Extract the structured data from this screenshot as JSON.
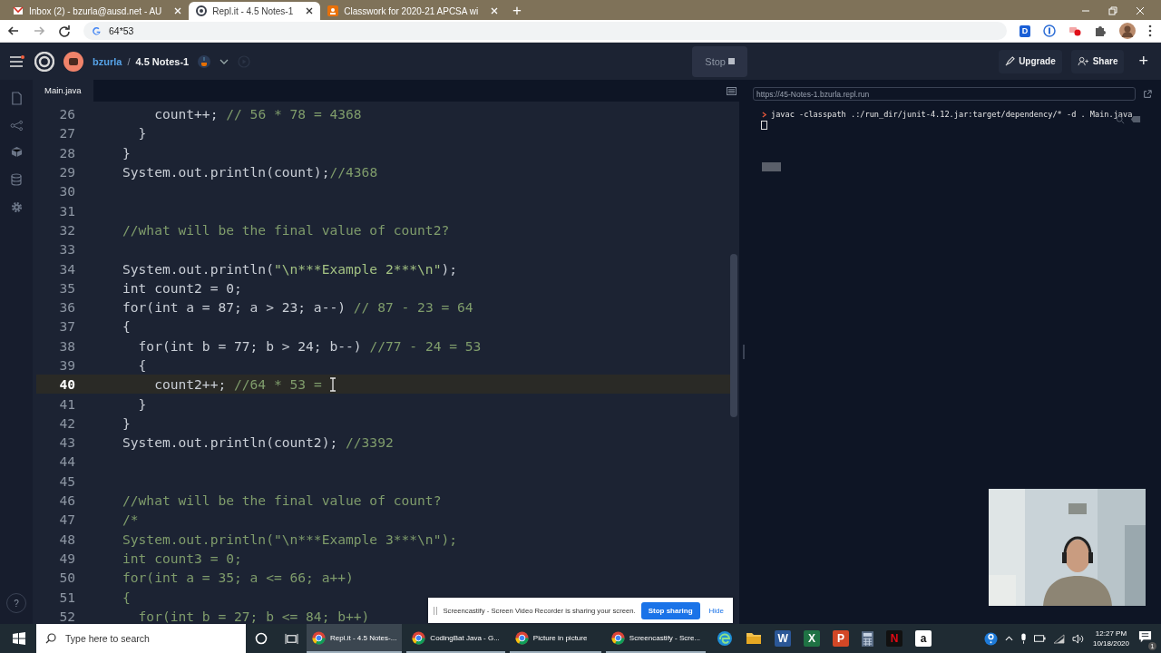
{
  "browser": {
    "tabs": [
      {
        "title": "Inbox (2) - bzurla@ausd.net - AU",
        "kind": "mail",
        "selected": false
      },
      {
        "title": "Repl.it - 4.5 Notes-1",
        "kind": "replit",
        "selected": true
      },
      {
        "title": "Classwork for 2020-21 APCSA wi",
        "kind": "classroom",
        "selected": false
      }
    ],
    "new_tab": "+",
    "address": "64*53",
    "extensions": [
      {
        "kind": "letter",
        "label": "D"
      },
      {
        "kind": "ring"
      },
      {
        "kind": "record"
      },
      {
        "kind": "puzzle"
      }
    ]
  },
  "header": {
    "user": "bzurla",
    "separator": "/",
    "project": "4.5 Notes-1",
    "stop_button": "Stop",
    "upgrade_button": "Upgrade",
    "share_button": "Share",
    "add_button": "+"
  },
  "editor": {
    "file_tab": "Main.java",
    "lines": [
      {
        "number": "26",
        "current": false,
        "parts": [
          {
            "kind": "code",
            "text": "    count++; "
          },
          {
            "kind": "comment",
            "text": "// 56 * 78 = 4368"
          }
        ]
      },
      {
        "number": "27",
        "current": false,
        "parts": [
          {
            "kind": "code",
            "text": "  }"
          }
        ]
      },
      {
        "number": "28",
        "current": false,
        "parts": [
          {
            "kind": "code",
            "text": "}"
          }
        ]
      },
      {
        "number": "29",
        "current": false,
        "parts": [
          {
            "kind": "code",
            "text": "System.out.println(count);"
          },
          {
            "kind": "comment",
            "text": "//4368"
          }
        ]
      },
      {
        "number": "30",
        "current": false
      },
      {
        "number": "31",
        "current": false
      },
      {
        "number": "32",
        "current": false,
        "parts": [
          {
            "kind": "comment",
            "text": "//what will be the final value of count2?"
          }
        ]
      },
      {
        "number": "33",
        "current": false
      },
      {
        "number": "34",
        "current": false,
        "parts": [
          {
            "kind": "code",
            "text": "System.out.println("
          },
          {
            "kind": "string",
            "text": "\"\\n***Example 2***\\n\""
          },
          {
            "kind": "code",
            "text": ");"
          }
        ]
      },
      {
        "number": "35",
        "current": false,
        "parts": [
          {
            "kind": "code",
            "text": "int count2 = 0;"
          }
        ]
      },
      {
        "number": "36",
        "current": false,
        "parts": [
          {
            "kind": "code",
            "text": "for(int a = 87; a > 23; a--) "
          },
          {
            "kind": "comment",
            "text": "// 87 - 23 = 64"
          }
        ]
      },
      {
        "number": "37",
        "current": false,
        "parts": [
          {
            "kind": "code",
            "text": "{"
          }
        ]
      },
      {
        "number": "38",
        "current": false,
        "parts": [
          {
            "kind": "code",
            "text": "  for(int b = 77; b > 24; b--) "
          },
          {
            "kind": "comment",
            "text": "//77 - 24 = 53"
          }
        ]
      },
      {
        "number": "39",
        "current": false,
        "parts": [
          {
            "kind": "code",
            "text": "  {"
          }
        ]
      },
      {
        "number": "40",
        "current": true,
        "parts": [
          {
            "kind": "code",
            "text": "    count2++; "
          },
          {
            "kind": "comment",
            "text": "//64 * 53 = "
          }
        ]
      },
      {
        "number": "41",
        "current": false,
        "parts": [
          {
            "kind": "code",
            "text": "  }"
          }
        ]
      },
      {
        "number": "42",
        "current": false,
        "parts": [
          {
            "kind": "code",
            "text": "}"
          }
        ]
      },
      {
        "number": "43",
        "current": false,
        "parts": [
          {
            "kind": "code",
            "text": "System.out.println(count2); "
          },
          {
            "kind": "comment",
            "text": "//3392"
          }
        ]
      },
      {
        "number": "44",
        "current": false
      },
      {
        "number": "45",
        "current": false
      },
      {
        "number": "46",
        "current": false,
        "parts": [
          {
            "kind": "comment",
            "text": "//what will be the final value of count?"
          }
        ]
      },
      {
        "number": "47",
        "current": false,
        "parts": [
          {
            "kind": "comment",
            "text": "/*"
          }
        ]
      },
      {
        "number": "48",
        "current": false,
        "parts": [
          {
            "kind": "comment",
            "text": "System.out.println(\"\\n***Example 3***\\n\");"
          }
        ]
      },
      {
        "number": "49",
        "current": false,
        "parts": [
          {
            "kind": "comment",
            "text": "int count3 = 0;"
          }
        ]
      },
      {
        "number": "50",
        "current": false,
        "parts": [
          {
            "kind": "comment",
            "text": "for(int a = 35; a <= 66; a++)"
          }
        ]
      },
      {
        "number": "51",
        "current": false,
        "parts": [
          {
            "kind": "comment",
            "text": "{"
          }
        ]
      },
      {
        "number": "52",
        "current": false,
        "parts": [
          {
            "kind": "comment",
            "text": "  for(int b = 27; b <= 84; b++)"
          }
        ]
      }
    ]
  },
  "console": {
    "url": "https://45-Notes-1.bzurla.repl.run",
    "command": "javac -classpath .:/run_dir/junit-4.12.jar:target/dependency/* -d . Main.java"
  },
  "help_button": "?",
  "sharing_bar": {
    "message": "Screencastify - Screen Video Recorder is sharing your screen.",
    "stop_button": "Stop sharing",
    "hide_link": "Hide"
  },
  "taskbar": {
    "search_placeholder": "Type here to search",
    "windows": [
      {
        "title": "Repl.it - 4.5 Notes-...",
        "selected": true
      },
      {
        "title": "CodingBat Java - G...",
        "selected": false
      },
      {
        "title": "Picture in picture",
        "selected": false
      },
      {
        "title": "Screencastify - Scre...",
        "selected": false
      }
    ],
    "pinned": [
      {
        "kind": "edge"
      },
      {
        "kind": "folder"
      },
      {
        "kind": "word",
        "label": "W"
      },
      {
        "kind": "excel",
        "label": "X"
      },
      {
        "kind": "powerpoint",
        "label": "P"
      },
      {
        "kind": "calculator"
      },
      {
        "kind": "netflix",
        "label": "N"
      },
      {
        "kind": "amazon",
        "label": "a"
      }
    ],
    "time": "12:27 PM",
    "date": "10/18/2020",
    "notifications": "1"
  }
}
